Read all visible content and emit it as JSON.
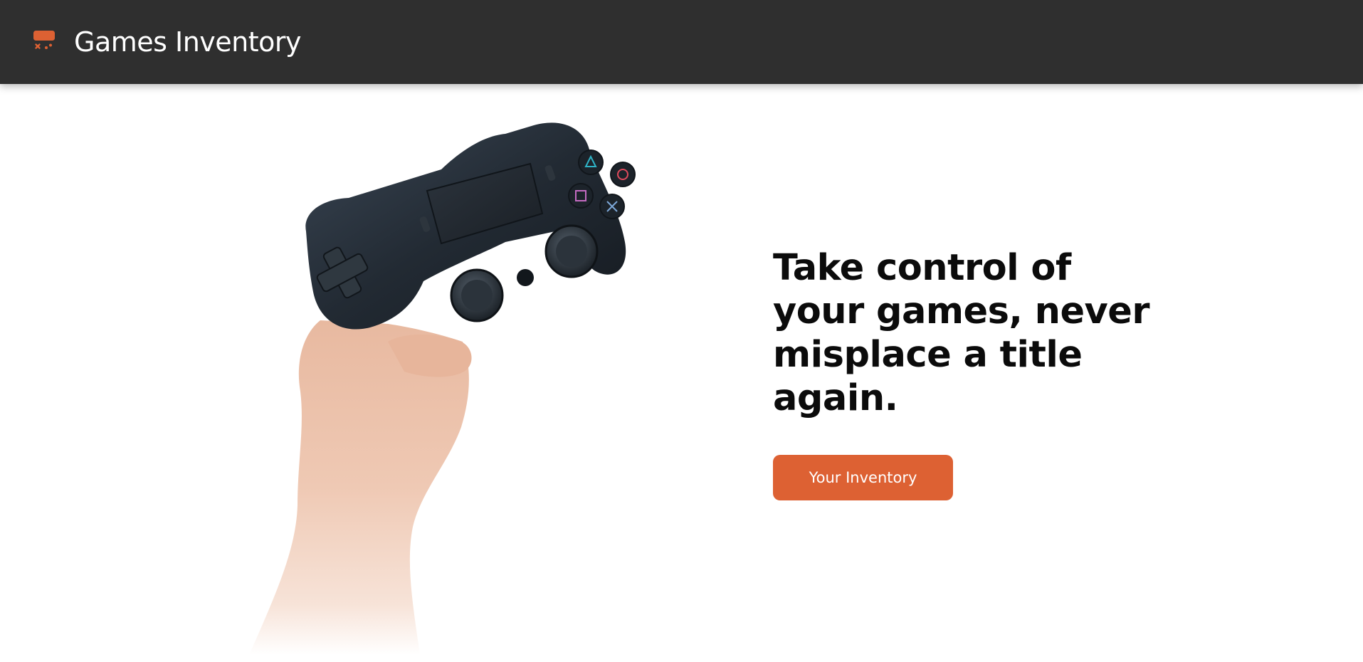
{
  "app": {
    "title": "Games Inventory",
    "logo_icon": "gamepad-logo-icon",
    "accent_color": "#dd6133",
    "navbar_color": "#2f2f2f"
  },
  "hero": {
    "headline": "Take control of\nyour games, never\nmisplace a title\nagain.",
    "cta_label": "Your Inventory",
    "image": {
      "icon": "hand-holding-game-controller-illustration"
    }
  }
}
